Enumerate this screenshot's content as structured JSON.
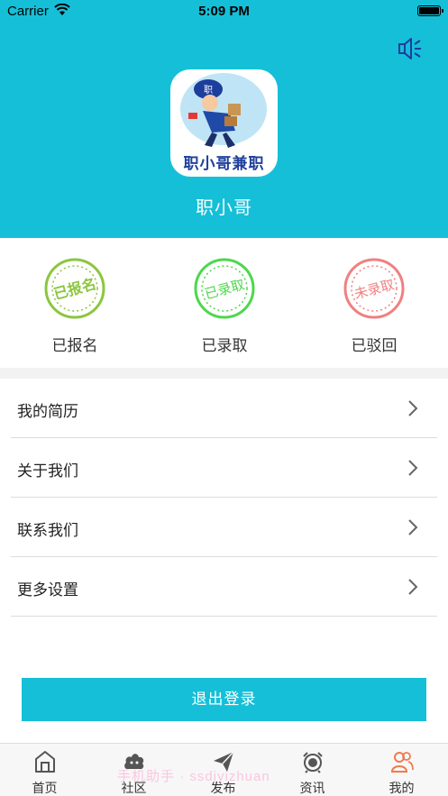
{
  "status_bar": {
    "carrier": "Carrier",
    "time": "5:09 PM"
  },
  "header": {
    "logo_text": "职小哥兼职",
    "app_name": "职小哥",
    "brand_color": "#15bfd8"
  },
  "stamps": [
    {
      "stamp_text": "已报名",
      "label": "已报名",
      "color": "#8cc63f"
    },
    {
      "stamp_text": "已录取",
      "label": "已录取",
      "color": "#4cd84c"
    },
    {
      "stamp_text": "未录取",
      "label": "已驳回",
      "color": "#f08080"
    }
  ],
  "menu": [
    {
      "label": "我的简历"
    },
    {
      "label": "关于我们"
    },
    {
      "label": "联系我们"
    },
    {
      "label": "更多设置"
    }
  ],
  "logout_label": "退出登录",
  "tabs": [
    {
      "label": "首页",
      "icon": "home-icon"
    },
    {
      "label": "社区",
      "icon": "community-icon"
    },
    {
      "label": "发布",
      "icon": "send-icon"
    },
    {
      "label": "资讯",
      "icon": "alarm-clock-icon"
    },
    {
      "label": "我的",
      "icon": "users-icon",
      "active": true
    }
  ],
  "watermark": "手机助手 · ssdiyizhuan"
}
